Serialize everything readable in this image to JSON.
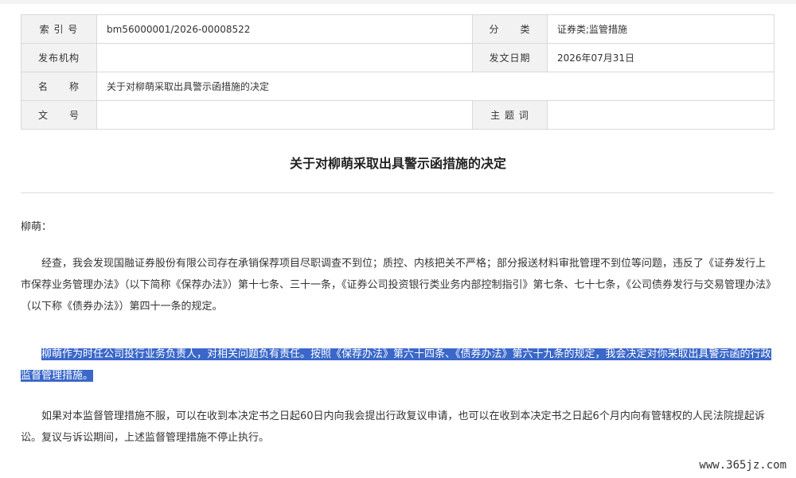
{
  "meta_table": {
    "rows": [
      {
        "label1": "索 引 号",
        "value1": "bm56000001/2026-00008522",
        "label2": "分　　类",
        "value2": "证券类;监管措施"
      },
      {
        "label1": "发布机构",
        "value1": "",
        "label2": "发文日期",
        "value2": "2026年07月31日"
      },
      {
        "label1": "名　　称",
        "value1": "关于对柳萌采取出具警示函措施的决定"
      },
      {
        "label1": "文　　号",
        "value1": "",
        "label2": "主 题 词",
        "value2": ""
      }
    ]
  },
  "document": {
    "title": "关于对柳萌采取出具警示函措施的决定",
    "salutation": "柳萌：",
    "paragraphs": [
      "经查，我会发现国融证券股份有限公司存在承销保荐项目尽职调查不到位；质控、内核把关不严格；部分报送材料审批管理不到位等问题，违反了《证券发行上市保荐业务管理办法》（以下简称《保荐办法》）第十七条、三十一条，《证券公司投资银行类业务内部控制指引》第七条、七十七条，《公司债券发行与交易管理办法》（以下称《债券办法》）第四十一条的规定。",
      "柳萌作为时任公司投行业务负责人，对相关问题负有责任。按照《保荐办法》第六十四条、《债券办法》第六十九条的规定，我会决定对你采取出具警示函的行政监督管理措施。",
      "如果对本监督管理措施不服，可以在收到本决定书之日起60日内向我会提出行政复议申请，也可以在收到本决定书之日起6个月内向有管辖权的人民法院提起诉讼。复议与诉讼期间，上述监督管理措施不停止执行。"
    ]
  },
  "watermark": "www.365jz.com",
  "colors": {
    "highlight": "#3a67c9",
    "label_bg": "#f2f2f2",
    "border": "#d9d9d9"
  }
}
